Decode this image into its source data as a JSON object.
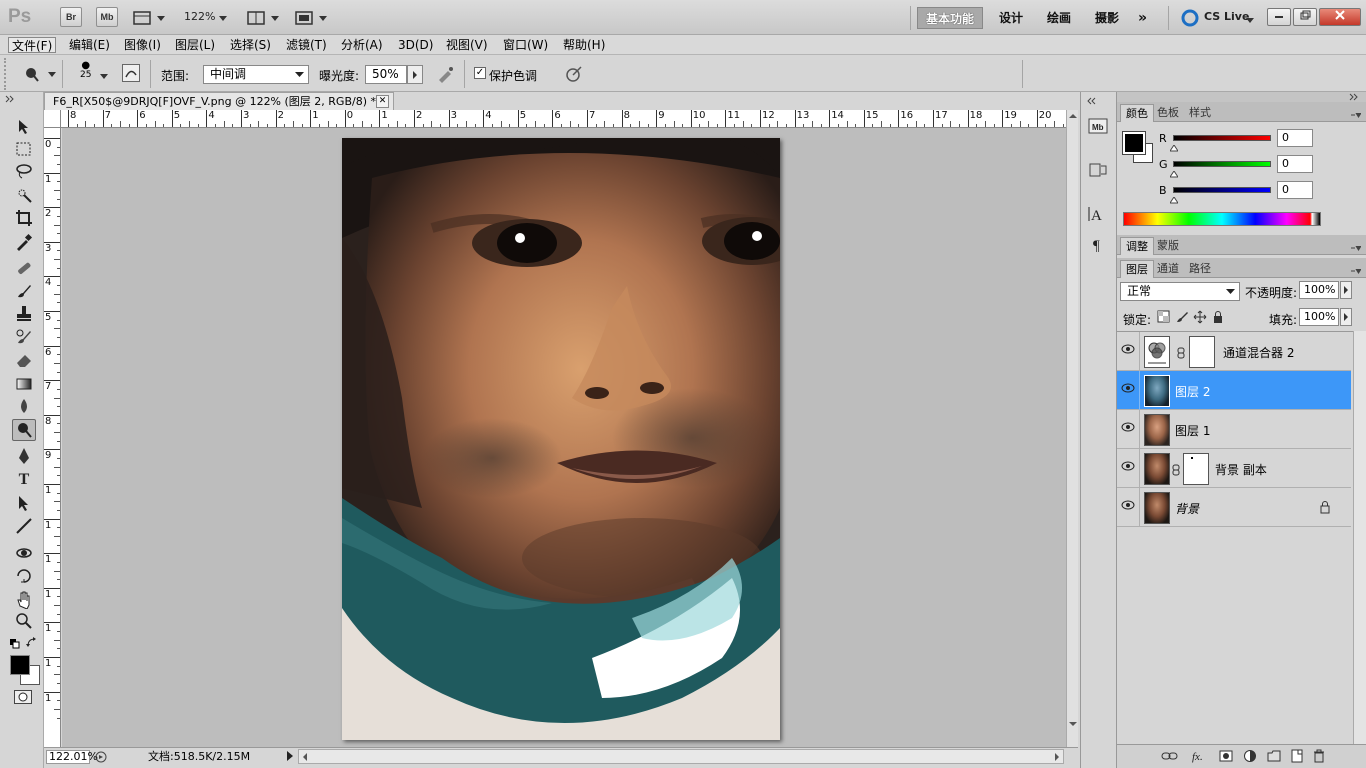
{
  "appbar": {
    "logo": "Ps",
    "br_label": "Br",
    "mb_label": "Mb",
    "zoom": "122%",
    "workspaces": [
      "基本功能",
      "设计",
      "绘画",
      "摄影"
    ],
    "more": "»",
    "cslive": "CS Live"
  },
  "menu": [
    "文件(F)",
    "编辑(E)",
    "图像(I)",
    "图层(L)",
    "选择(S)",
    "滤镜(T)",
    "分析(A)",
    "3D(D)",
    "视图(V)",
    "窗口(W)",
    "帮助(H)"
  ],
  "options": {
    "brush_size": "25",
    "range_label": "范围:",
    "range_value": "中间调",
    "exposure_label": "曝光度:",
    "exposure_value": "50%",
    "protect_tones": "保护色调"
  },
  "document": {
    "tab_title": "F6_R[X50$@9DRJQ[F]OVF_V.png @ 122% (图层 2, RGB/8) *",
    "ruler_top": [
      "8",
      "7",
      "6",
      "5",
      "4",
      "3",
      "2",
      "1",
      "0",
      "1",
      "2",
      "3",
      "4",
      "5",
      "6",
      "7",
      "8",
      "9",
      "10",
      "11",
      "12",
      "13",
      "14",
      "15",
      "16",
      "17",
      "18",
      "19",
      "20"
    ],
    "ruler_left": [
      "0",
      "1",
      "2",
      "3",
      "4",
      "5",
      "6",
      "7",
      "8",
      "9",
      "1",
      "1",
      "1",
      "1",
      "1",
      "1",
      "1"
    ],
    "zoom_status": "122.01%",
    "doc_info": "文档:518.5K/2.15M"
  },
  "color_panel": {
    "tabs": [
      "颜色",
      "色板",
      "样式"
    ],
    "channels": [
      {
        "label": "R",
        "value": "0"
      },
      {
        "label": "G",
        "value": "0"
      },
      {
        "label": "B",
        "value": "0"
      }
    ],
    "foreground": "#000000",
    "background": "#ffffff"
  },
  "adjust_panel": {
    "tabs": [
      "调整",
      "蒙版"
    ]
  },
  "layers_panel": {
    "tabs": [
      "图层",
      "通道",
      "路径"
    ],
    "blend_mode": "正常",
    "opacity_label": "不透明度:",
    "opacity_value": "100%",
    "lock_label": "锁定:",
    "fill_label": "填充:",
    "fill_value": "100%",
    "layers": [
      {
        "name": "通道混合器 2",
        "type": "adjustment",
        "selected": false
      },
      {
        "name": "图层 2",
        "type": "image",
        "selected": true
      },
      {
        "name": "图层 1",
        "type": "image",
        "selected": false
      },
      {
        "name": "背景 副本",
        "type": "image-mask",
        "selected": false
      },
      {
        "name": "背景",
        "type": "background",
        "selected": false
      }
    ]
  },
  "colors": {
    "accent": "#3d97f8",
    "canvas": "#bdbdbd",
    "chrome": "#d6d6d6"
  }
}
